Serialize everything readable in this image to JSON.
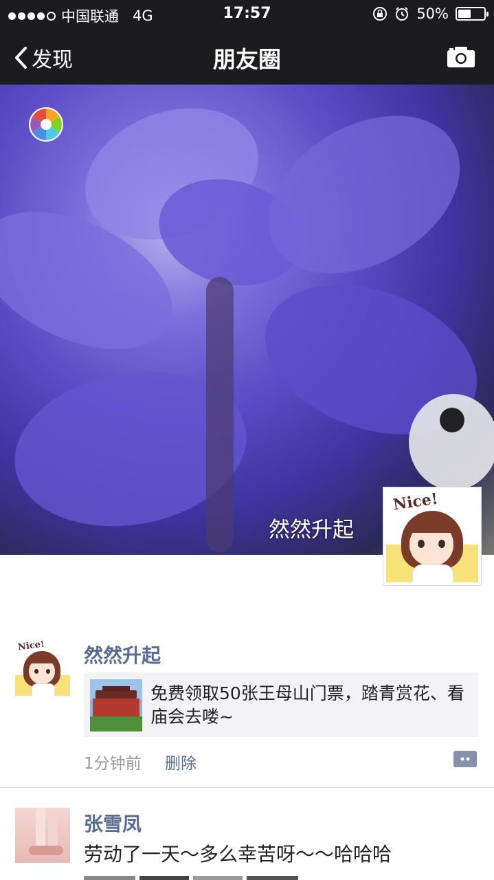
{
  "status_bar": {
    "carrier": "中国联通",
    "network": "4G",
    "time": "17:57",
    "battery": "50%",
    "battery_level": 0.5
  },
  "nav": {
    "back_label": "发现",
    "title": "朋友圈",
    "camera_icon": "camera-icon"
  },
  "cover": {
    "user_name": "然然升起",
    "avatar_caption": "Nice!"
  },
  "posts": [
    {
      "author": "然然升起",
      "avatar_caption": "Nice!",
      "link_text": "免费领取50张王母山门票，踏青赏花、看庙会去喽~",
      "time": "1分钟前",
      "delete_label": "删除"
    },
    {
      "author": "张雪凤",
      "text": "劳动了一天～多么幸苦呀～～哈哈哈"
    }
  ],
  "colors": {
    "bar_bg": "#1c1c1e",
    "name_blue": "#576b95",
    "card_bg": "#f3f3f5"
  }
}
